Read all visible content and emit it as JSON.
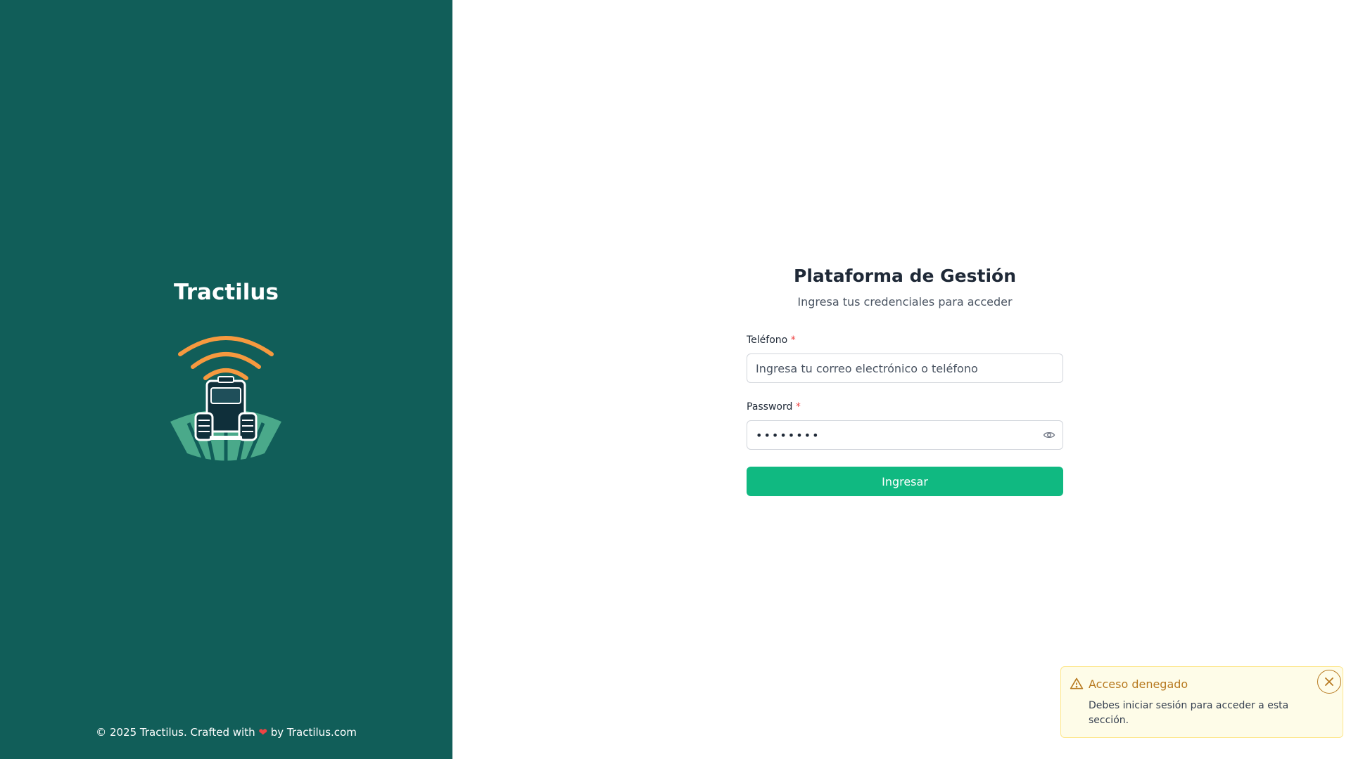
{
  "brand": {
    "name": "Tractilus",
    "footer_prefix": "© 2025 Tractilus. Crafted with",
    "footer_heart": "❤",
    "footer_suffix": "by Tractilus.com"
  },
  "login": {
    "title": "Plataforma de Gestión",
    "subtitle": "Ingresa tus credenciales para acceder",
    "phone": {
      "label": "Teléfono",
      "required_mark": "*",
      "placeholder": "Ingresa tu correo electrónico o teléfono",
      "value": ""
    },
    "password": {
      "label": "Password",
      "required_mark": "*",
      "value": "••••••••",
      "toggle_icon": "eye-icon"
    },
    "submit_label": "Ingresar"
  },
  "toast": {
    "type": "warning",
    "icon": "warning-icon",
    "title": "Acceso denegado",
    "message": "Debes iniciar sesión para acceder a esta sección.",
    "close_icon": "close-icon"
  },
  "colors": {
    "sidebar_bg": "#115e59",
    "primary": "#10b981",
    "logo_orange": "#f6993f",
    "logo_green": "#4aa98a",
    "required": "#ef4444",
    "warning_text": "#b7791f",
    "warning_bg": "#fefce8"
  }
}
